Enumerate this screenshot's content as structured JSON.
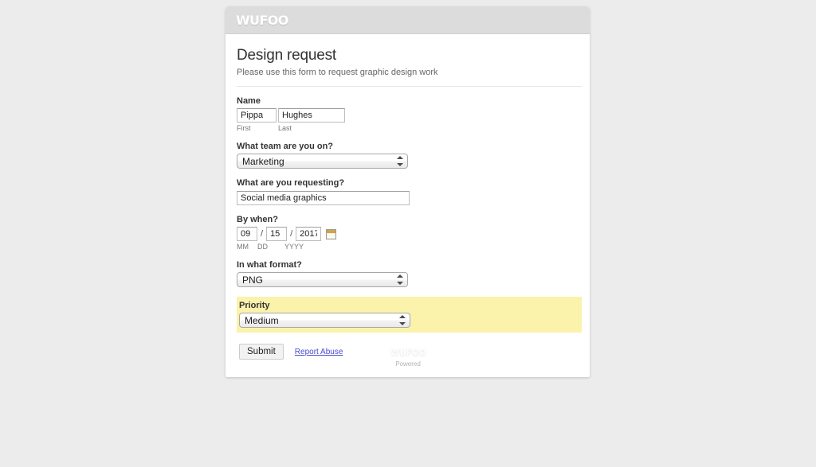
{
  "header": {
    "logo_text": "WUFOO"
  },
  "form": {
    "title": "Design request",
    "subtitle": "Please use this form to request graphic design work",
    "fields": {
      "name": {
        "label": "Name",
        "first_value": "Pippa",
        "last_value": "Hughes",
        "first_sublabel": "First",
        "last_sublabel": "Last"
      },
      "team": {
        "label": "What team are you on?",
        "value": "Marketing",
        "options": [
          "Marketing"
        ]
      },
      "request": {
        "label": "What are you requesting?",
        "value": "Social media graphics"
      },
      "date": {
        "label": "By when?",
        "month_value": "09",
        "day_value": "15",
        "year_value": "2017",
        "month_sublabel": "MM",
        "day_sublabel": "DD",
        "year_sublabel": "YYYY",
        "separator": "/",
        "picker_icon": "calendar-icon"
      },
      "format": {
        "label": "In what format?",
        "value": "PNG",
        "options": [
          "PNG"
        ]
      },
      "priority": {
        "label": "Priority",
        "value": "Medium",
        "options": [
          "Medium"
        ],
        "highlight_color": "#fbf2ab"
      }
    },
    "actions": {
      "submit_label": "Submit",
      "report_abuse_label": "Report Abuse",
      "link_color": "#4a4ad0"
    }
  },
  "footer": {
    "logo_text": "WUFOO",
    "powered_text": "Powered"
  },
  "colors": {
    "page_background": "#ececec",
    "header_background": "#dcdcdc",
    "container_background": "#ffffff"
  }
}
